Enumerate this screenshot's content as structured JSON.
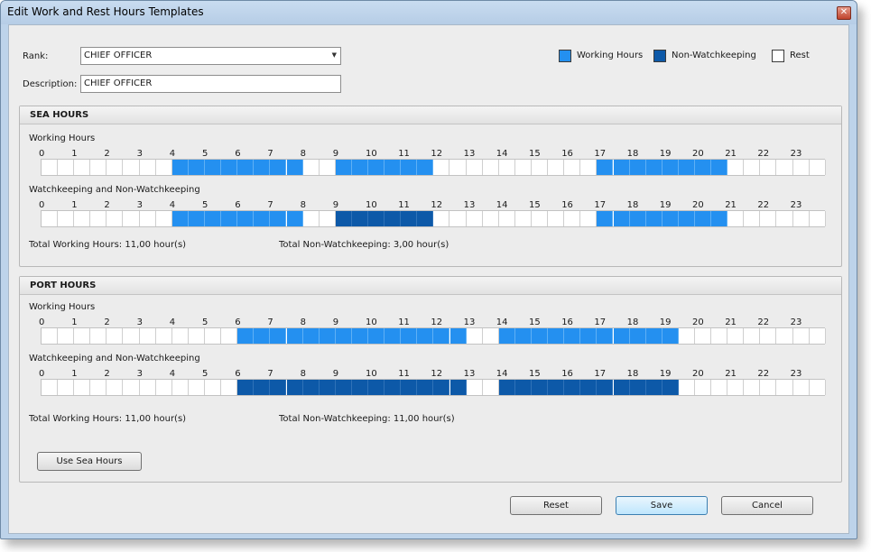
{
  "window": {
    "title": "Edit Work and Rest Hours Templates"
  },
  "form": {
    "rank_label": "Rank:",
    "rank_value": "CHIEF OFFICER",
    "description_label": "Description:",
    "description_value": "CHIEF OFFICER"
  },
  "legend": [
    {
      "label": "Working Hours",
      "color": "#2490f0"
    },
    {
      "label": "Non-Watchkeeping",
      "color": "#0d59a8"
    },
    {
      "label": "Rest",
      "color": "#ffffff"
    }
  ],
  "hour_labels": [
    "0",
    "1",
    "2",
    "3",
    "4",
    "5",
    "6",
    "7",
    "8",
    "9",
    "10",
    "11",
    "12",
    "13",
    "14",
    "15",
    "16",
    "17",
    "18",
    "19",
    "20",
    "21",
    "22",
    "23"
  ],
  "sea": {
    "title": "SEA HOURS",
    "working_label": "Working Hours",
    "watch_label": "Watchkeeping and Non-Watchkeeping",
    "working_slots": "0000000011111111001111110000000000111111110000000000000000000000",
    "watch_slots": "0000000011111111002222220000000000111111110000000000000000000000",
    "total_working": "Total Working Hours:  11,00 hour(s)",
    "total_nonwatch": "Total Non-Watchkeeping:  3,00 hour(s)"
  },
  "port": {
    "title": "PORT HOURS",
    "working_label": "Working Hours",
    "watch_label": "Watchkeeping and Non-Watchkeeping",
    "working_slots": "0000000000001111111111111100111111111110000000000000000000000000",
    "watch_slots": "0000000000002222222222222200222222222220000000000000000000000000",
    "total_working": "Total Working Hours:  11,00 hour(s)",
    "total_nonwatch": "Total Non-Watchkeeping:  11,00 hour(s)",
    "use_sea_button": "Use Sea Hours"
  },
  "buttons": {
    "reset": "Reset",
    "save": "Save",
    "cancel": "Cancel"
  }
}
